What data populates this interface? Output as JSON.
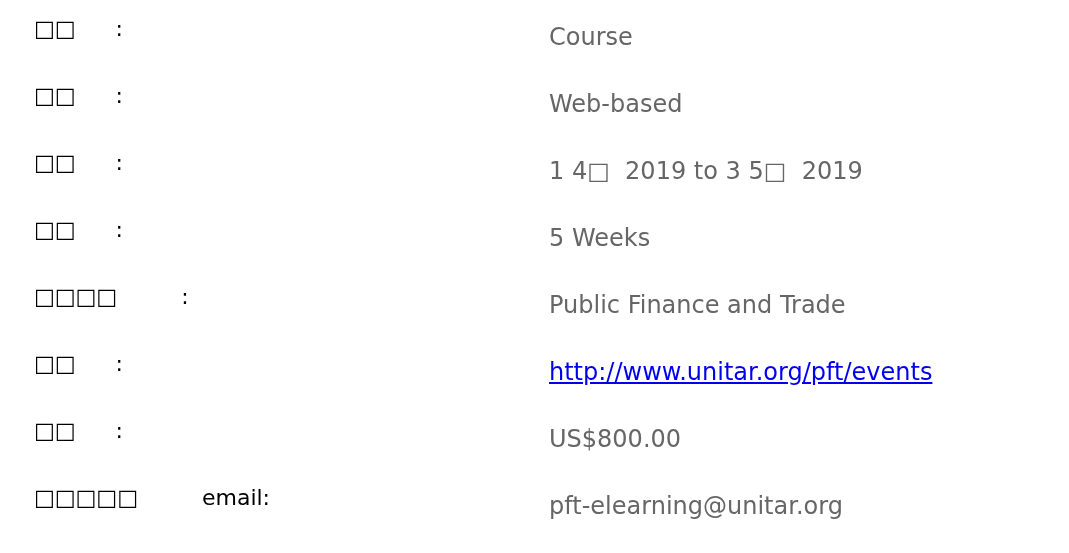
{
  "rows": [
    {
      "label": "□□",
      "suffix": ":",
      "value": "Course",
      "kind": "text"
    },
    {
      "label": "□□",
      "suffix": ":",
      "value": "Web-based",
      "kind": "text"
    },
    {
      "label": "□□",
      "suffix": ":",
      "value": "1 4□  2019 to 3 5□  2019",
      "kind": "text"
    },
    {
      "label": "□□",
      "suffix": ":",
      "value": "5 Weeks",
      "kind": "text"
    },
    {
      "label": "□□□□",
      "suffix": ":",
      "value": "Public Finance and Trade",
      "kind": "text"
    },
    {
      "label": "□□",
      "suffix": ":",
      "value": "http://www.unitar.org/pft/events",
      "kind": "link"
    },
    {
      "label": "□□",
      "suffix": ":",
      "value": "US$800.00",
      "kind": "text"
    },
    {
      "label": "□□□□□",
      "suffix": "email:",
      "value": "pft-elearning@unitar.org",
      "kind": "text"
    }
  ]
}
